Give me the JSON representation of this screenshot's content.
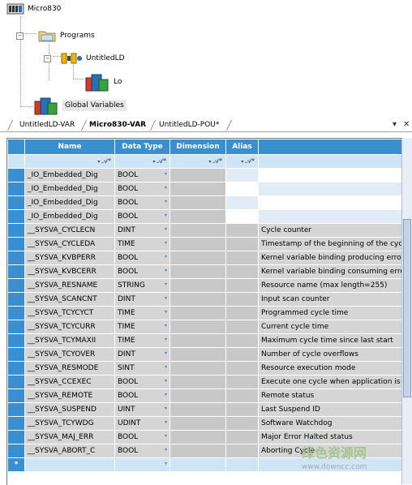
{
  "tree": {
    "root": "Micro830",
    "programs": "Programs",
    "program_item": "UntitledLD",
    "local_item": "Lo",
    "global_vars": "Global Variables",
    "expander_symbol": "−"
  },
  "tabs": [
    {
      "label": "UntitledLD-VAR",
      "active": false
    },
    {
      "label": "Micro830-VAR",
      "active": true
    },
    {
      "label": "UntitledLD-POU*",
      "active": false
    }
  ],
  "tab_controls": {
    "menu": "▾",
    "close": "✕"
  },
  "grid": {
    "columns": {
      "name": "Name",
      "data_type": "Data Type",
      "dimension": "Dimension",
      "alias": "Alias"
    },
    "filter_symbol": "▾",
    "filter_icon": "𝒜*",
    "new_row_marker": "*",
    "rows": [
      {
        "name": "_IO_Embedded_Dig",
        "type": "BOOL",
        "comment": ""
      },
      {
        "name": "_IO_Embedded_Dig",
        "type": "BOOL",
        "comment": ""
      },
      {
        "name": "_IO_Embedded_Dig",
        "type": "BOOL",
        "comment": ""
      },
      {
        "name": "_IO_Embedded_Dig",
        "type": "BOOL",
        "comment": ""
      },
      {
        "name": "__SYSVA_CYCLECN",
        "type": "DINT",
        "comment": "Cycle counter"
      },
      {
        "name": "__SYSVA_CYCLEDA",
        "type": "TIME",
        "comment": "Timestamp of the beginning of the cyc"
      },
      {
        "name": "__SYSVA_KVBPERR",
        "type": "BOOL",
        "comment": "Kernel variable binding producing error"
      },
      {
        "name": "__SYSVA_KVBCERR",
        "type": "BOOL",
        "comment": "Kernel variable binding consuming erro"
      },
      {
        "name": "__SYSVA_RESNAME",
        "type": "STRING",
        "comment": "Resource name (max length=255)"
      },
      {
        "name": "__SYSVA_SCANCNT",
        "type": "DINT",
        "comment": "Input scan counter"
      },
      {
        "name": "__SYSVA_TCYCYCT",
        "type": "TIME",
        "comment": "Programmed cycle time"
      },
      {
        "name": "__SYSVA_TCYCURR",
        "type": "TIME",
        "comment": "Current cycle time"
      },
      {
        "name": "__SYSVA_TCYMAXII",
        "type": "TIME",
        "comment": "Maximum cycle time since last start"
      },
      {
        "name": "__SYSVA_TCYOVER",
        "type": "DINT",
        "comment": "Number of cycle overflows"
      },
      {
        "name": "__SYSVA_RESMODE",
        "type": "SINT",
        "comment": "Resource execution mode"
      },
      {
        "name": "__SYSVA_CCEXEC",
        "type": "BOOL",
        "comment": "Execute one cycle when application is"
      },
      {
        "name": "__SYSVA_REMOTE",
        "type": "BOOL",
        "comment": "Remote status"
      },
      {
        "name": "__SYSVA_SUSPEND",
        "type": "UINT",
        "comment": "Last Suspend ID"
      },
      {
        "name": "__SYSVA_TCYWDG",
        "type": "UDINT",
        "comment": "Software Watchdog"
      },
      {
        "name": "__SYSVA_MAJ_ERR",
        "type": "BOOL",
        "comment": "Major Error Halted status"
      },
      {
        "name": "__SYSVA_ABORT_C",
        "type": "BOOL",
        "comment": "Aborting Cycle"
      }
    ]
  },
  "watermark": {
    "line1": "绿色资源网",
    "line2": "www.downcc.com"
  },
  "colors": {
    "header": "#3a8fd0",
    "filter_row": "#cfe4f5",
    "readonly": "#d5d5d5"
  }
}
